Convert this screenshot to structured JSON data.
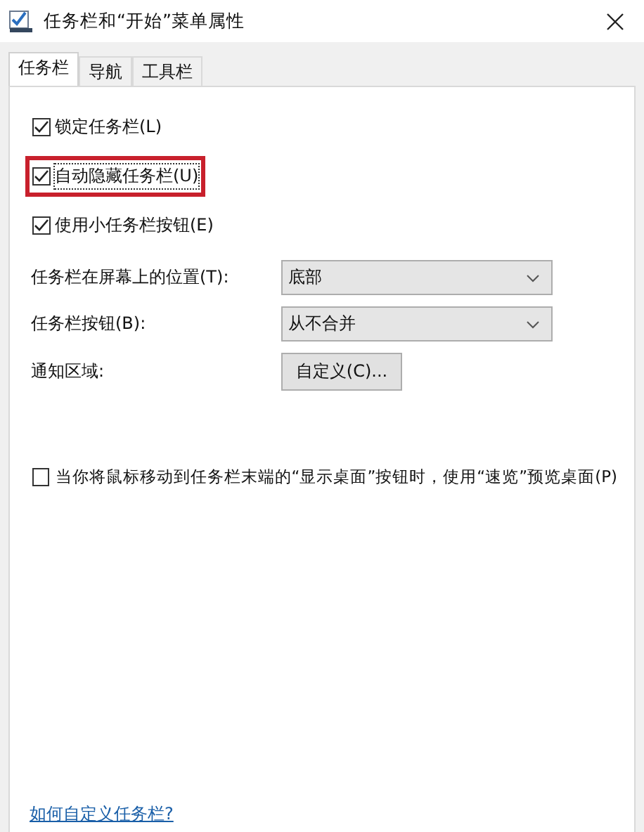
{
  "window": {
    "title": "任务栏和“开始”菜单属性"
  },
  "tabs": [
    {
      "label": "任务栏",
      "selected": true
    },
    {
      "label": "导航",
      "selected": false
    },
    {
      "label": "工具栏",
      "selected": false
    }
  ],
  "options": [
    {
      "label": "锁定任务栏(L)",
      "checked": true,
      "highlighted": false
    },
    {
      "label": "自动隐藏任务栏(U)",
      "checked": true,
      "highlighted": true
    },
    {
      "label": "使用小任务栏按钮(E)",
      "checked": true,
      "highlighted": false
    }
  ],
  "settings": [
    {
      "kind": "dropdown",
      "label": "任务栏在屏幕上的位置(T):",
      "value": "底部"
    },
    {
      "kind": "dropdown",
      "label": "任务栏按钮(B):",
      "value": "从不合并"
    },
    {
      "kind": "button",
      "label": "通知区域:",
      "value": "自定义(C)..."
    }
  ],
  "peek_option": {
    "label": "当你将鼠标移动到任务栏末端的“显示桌面”按钮时，使用“速览”预览桌面(P)",
    "checked": false
  },
  "help_link": "如何自定义任务栏?"
}
